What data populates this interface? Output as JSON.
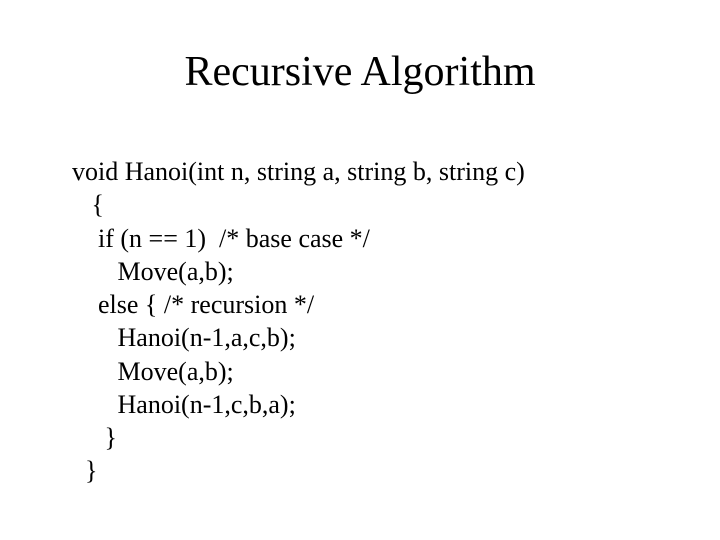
{
  "slide": {
    "title": "Recursive Algorithm",
    "code": {
      "l1": "void Hanoi(int n, string a, string b, string c)",
      "l2": "   {",
      "l3": "    if (n == 1)  /* base case */",
      "l4": "       Move(a,b);",
      "l5": "    else { /* recursion */",
      "l6": "       Hanoi(n-1,a,c,b);",
      "l7": "       Move(a,b);",
      "l8": "       Hanoi(n-1,c,b,a);",
      "l9": "     }",
      "l10": "  }"
    }
  }
}
